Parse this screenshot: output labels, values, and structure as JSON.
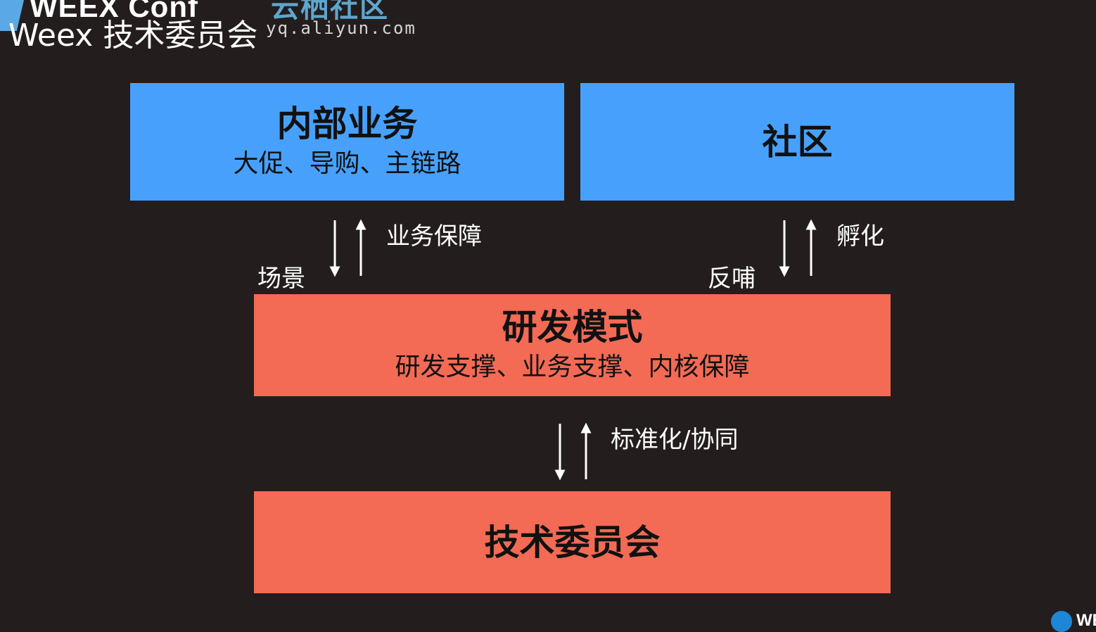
{
  "header": {
    "logo_text": "WEEX Conf",
    "title": "Weex 技术委员会",
    "watermark_cn": "云栖社区",
    "watermark_url": "yq.aliyun.com"
  },
  "boxes": {
    "internal": {
      "title": "内部业务",
      "subtitle": "大促、导购、主链路"
    },
    "community": {
      "title": "社区"
    },
    "rd": {
      "title": "研发模式",
      "subtitle": "研发支撑、业务支撑、内核保障"
    },
    "committee": {
      "title": "技术委员会"
    }
  },
  "links": {
    "internal_down": "场景",
    "internal_up": "业务保障",
    "community_down": "反哺",
    "community_up": "孵化",
    "committee": "标准化/协同"
  },
  "footer": {
    "corner_text": "WE"
  },
  "colors": {
    "background": "#231e1d",
    "blue_box": "#47a1fc",
    "red_box": "#f36a55",
    "watermark": "#5fa6cf"
  }
}
